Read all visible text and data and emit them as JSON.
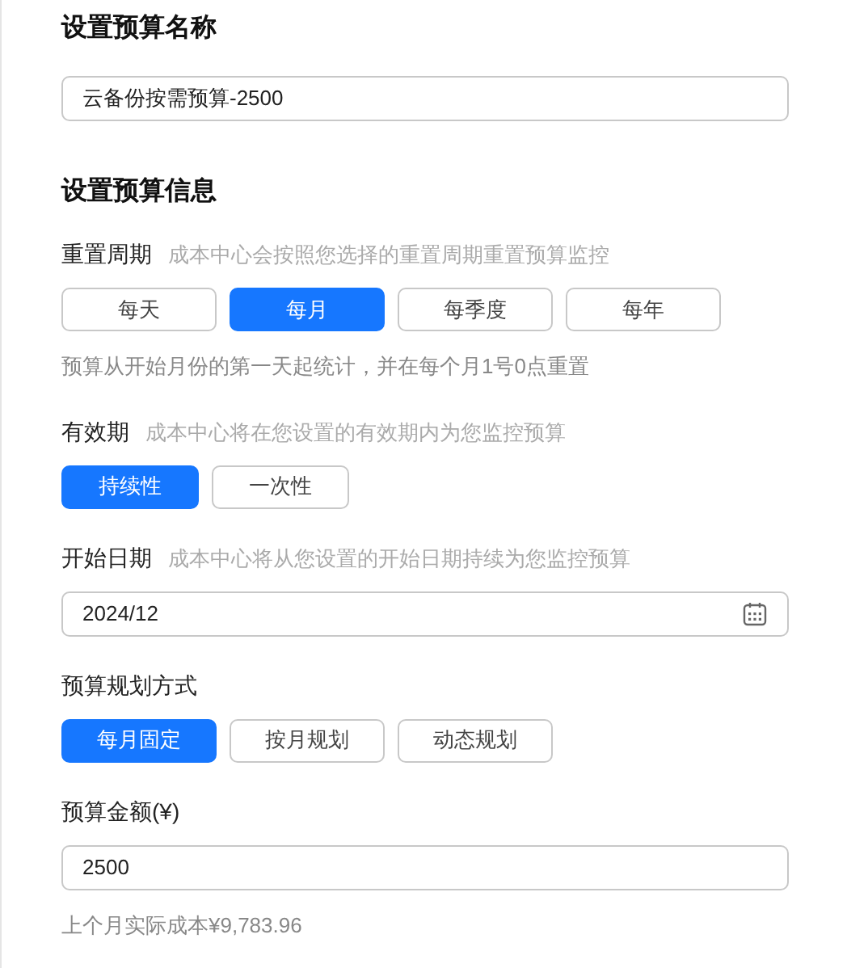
{
  "name_section": {
    "title": "设置预算名称",
    "value": "云备份按需预算-2500"
  },
  "info_section": {
    "title": "设置预算信息",
    "fields": [
      {
        "kind": "options",
        "label": "重置周期",
        "hint": "成本中心会按照您选择的重置周期重置预算监控",
        "options": [
          {
            "label": "每天",
            "selected": false
          },
          {
            "label": "每月",
            "selected": true
          },
          {
            "label": "每季度",
            "selected": false
          },
          {
            "label": "每年",
            "selected": false
          }
        ],
        "note": "预算从开始月份的第一天起统计，并在每个月1号0点重置"
      },
      {
        "kind": "options",
        "label": "有效期",
        "hint": "成本中心将在您设置的有效期内为您监控预算",
        "options": [
          {
            "label": "持续性",
            "selected": true
          },
          {
            "label": "一次性",
            "selected": false
          }
        ]
      },
      {
        "kind": "date",
        "label": "开始日期",
        "hint": "成本中心将从您设置的开始日期持续为您监控预算",
        "value": "2024/12"
      },
      {
        "kind": "options",
        "label": "预算规划方式",
        "options": [
          {
            "label": "每月固定",
            "selected": true
          },
          {
            "label": "按月规划",
            "selected": false
          },
          {
            "label": "动态规划",
            "selected": false
          }
        ]
      },
      {
        "kind": "text",
        "label": "预算金额(¥)",
        "value": "2500",
        "note": "上个月实际成本¥9,783.96"
      }
    ]
  }
}
